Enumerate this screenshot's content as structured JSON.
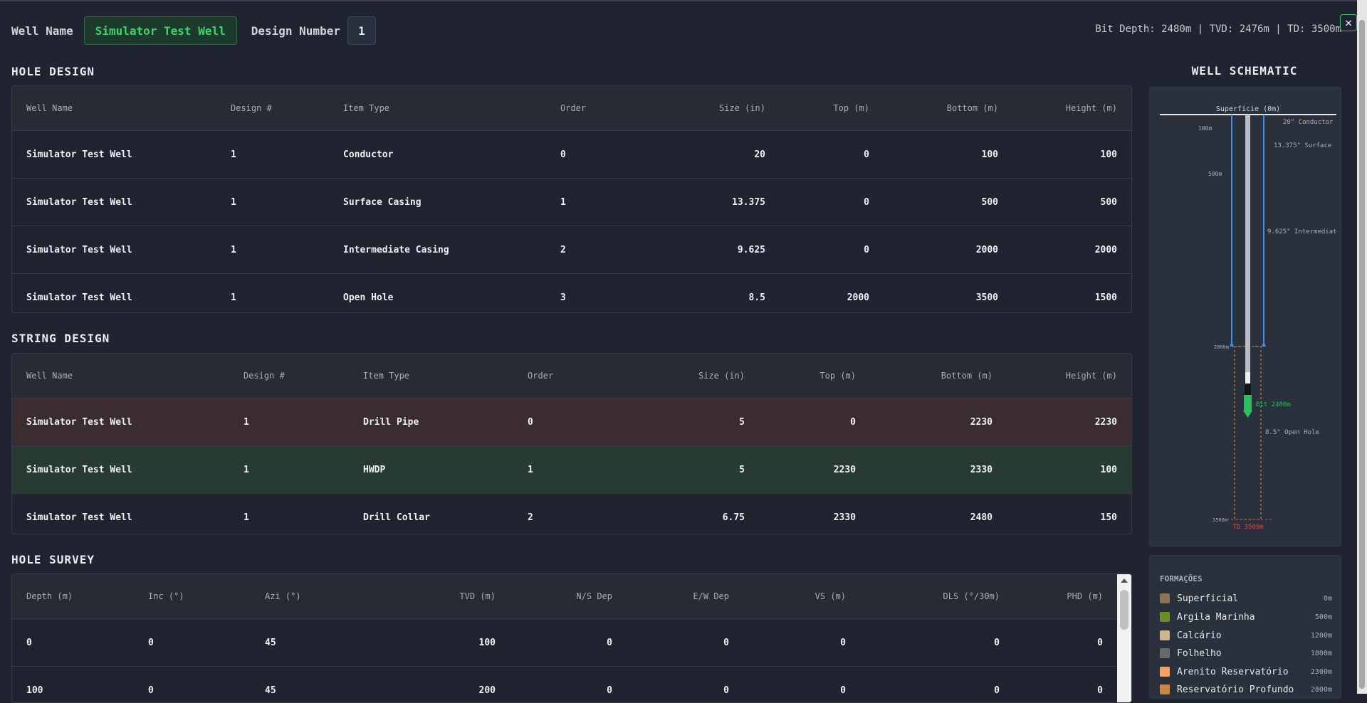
{
  "header": {
    "well_name_label": "Well Name",
    "well_name_value": "Simulator Test Well",
    "design_number_label": "Design Number",
    "design_number_value": "1",
    "status": "Bit Depth: 2480m | TVD: 2476m | TD: 3500m",
    "close_icon": "×"
  },
  "hole_design": {
    "title": "HOLE DESIGN",
    "columns": [
      "Well Name",
      "Design #",
      "Item Type",
      "Order",
      "Size (in)",
      "Top (m)",
      "Bottom (m)",
      "Height (m)"
    ],
    "rows": [
      [
        "Simulator Test Well",
        "1",
        "Conductor",
        "0",
        "20",
        "0",
        "100",
        "100"
      ],
      [
        "Simulator Test Well",
        "1",
        "Surface Casing",
        "1",
        "13.375",
        "0",
        "500",
        "500"
      ],
      [
        "Simulator Test Well",
        "1",
        "Intermediate Casing",
        "2",
        "9.625",
        "0",
        "2000",
        "2000"
      ],
      [
        "Simulator Test Well",
        "1",
        "Open Hole",
        "3",
        "8.5",
        "2000",
        "3500",
        "1500"
      ]
    ]
  },
  "string_design": {
    "title": "STRING DESIGN",
    "columns": [
      "Well Name",
      "Design #",
      "Item Type",
      "Order",
      "Size (in)",
      "Top (m)",
      "Bottom (m)",
      "Height (m)"
    ],
    "rows": [
      [
        "Simulator Test Well",
        "1",
        "Drill Pipe",
        "0",
        "5",
        "0",
        "2230",
        "2230"
      ],
      [
        "Simulator Test Well",
        "1",
        "HWDP",
        "1",
        "5",
        "2230",
        "2330",
        "100"
      ],
      [
        "Simulator Test Well",
        "1",
        "Drill Collar",
        "2",
        "6.75",
        "2330",
        "2480",
        "150"
      ]
    ],
    "row_colors": [
      "#3a2c31",
      "#273b33",
      ""
    ]
  },
  "hole_survey": {
    "title": "HOLE SURVEY",
    "columns": [
      "Depth (m)",
      "Inc (°)",
      "Azi (°)",
      "TVD (m)",
      "N/S Dep",
      "E/W Dep",
      "VS (m)",
      "DLS (°/30m)",
      "PHD (m)"
    ],
    "rows": [
      [
        "0",
        "0",
        "45",
        "100",
        "0",
        "0",
        "0",
        "0",
        "0"
      ],
      [
        "100",
        "0",
        "45",
        "200",
        "0",
        "0",
        "0",
        "0",
        "0"
      ]
    ]
  },
  "schematic": {
    "title": "WELL SCHEMATIC",
    "surface_label": "Superfície (0m)",
    "depth_labels": [
      "100m",
      "500m",
      "2000m",
      "3500m"
    ],
    "casing_labels": [
      "20\" Conductor",
      "13.375\" Surface",
      "9.625\" Intermediat",
      "8.5\" Open Hole"
    ],
    "bit_label": "Bit 2480m",
    "td_label": "TD 3500m",
    "colors": {
      "casing": "#3a8ee6",
      "pipe": "#b9bdc3",
      "bit": "#27c05a",
      "td": "#e64545",
      "openhole": "#e8924a"
    }
  },
  "formations": {
    "title": "FORMAÇÕES",
    "items": [
      {
        "name": "Superficial",
        "depth": "0m",
        "color": "#8b7355"
      },
      {
        "name": "Argila Marinha",
        "depth": "500m",
        "color": "#6b8e23"
      },
      {
        "name": "Calcário",
        "depth": "1200m",
        "color": "#d2b48c"
      },
      {
        "name": "Folhelho",
        "depth": "1800m",
        "color": "#696969"
      },
      {
        "name": "Arenito Reservatório",
        "depth": "2300m",
        "color": "#f4a460"
      },
      {
        "name": "Reservatório Profundo",
        "depth": "2800m",
        "color": "#cd853f"
      }
    ]
  }
}
